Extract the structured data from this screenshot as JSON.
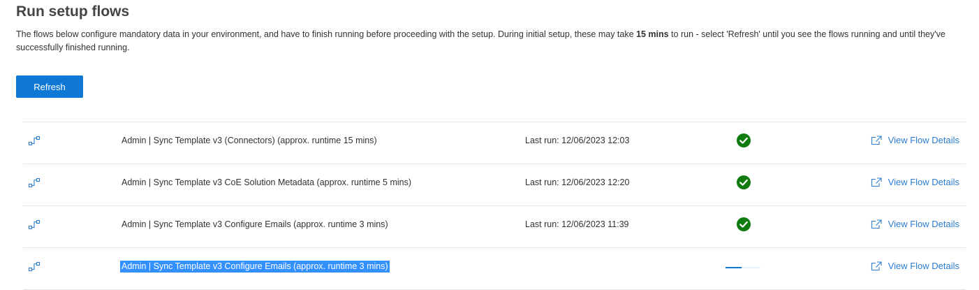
{
  "page": {
    "title": "Run setup flows",
    "description": {
      "before": "The flows below configure mandatory data in your environment, and have to finish running before proceeding with the setup. During initial setup, these may take ",
      "emphasis": "15 mins",
      "after": " to run - select 'Refresh' until you see the flows running and until they've successfully finished running."
    },
    "refresh_label": "Refresh"
  },
  "flows": [
    {
      "icon": "flow-icon",
      "name": "Admin | Sync Template v3 (Connectors) (approx. runtime 15 mins)",
      "last_run": "Last run: 12/06/2023 12:03",
      "status": "success",
      "status_icon": "check-circle-icon",
      "link_label": "View Flow Details"
    },
    {
      "icon": "flow-icon",
      "name": "Admin | Sync Template v3 CoE Solution Metadata (approx. runtime 5 mins)",
      "last_run": "Last run: 12/06/2023 12:20",
      "status": "success",
      "status_icon": "check-circle-icon",
      "link_label": "View Flow Details"
    },
    {
      "icon": "flow-icon",
      "name": "Admin | Sync Template v3 Configure Emails (approx. runtime 3 mins)",
      "last_run": "Last run: 12/06/2023 11:39",
      "status": "success",
      "status_icon": "check-circle-icon",
      "link_label": "View Flow Details"
    },
    {
      "icon": "flow-icon",
      "name": "Admin | Sync Template v3 Configure Emails (approx. runtime 3 mins)",
      "last_run": "",
      "status": "running",
      "status_icon": "progress-indicator",
      "progress": 0.45,
      "selected": true,
      "link_label": "View Flow Details"
    }
  ],
  "colors": {
    "primary": "#0f78d4",
    "link": "#2a7ccd",
    "success": "#107c10",
    "selection": "#3390ff",
    "divider": "#e4e4e4"
  }
}
